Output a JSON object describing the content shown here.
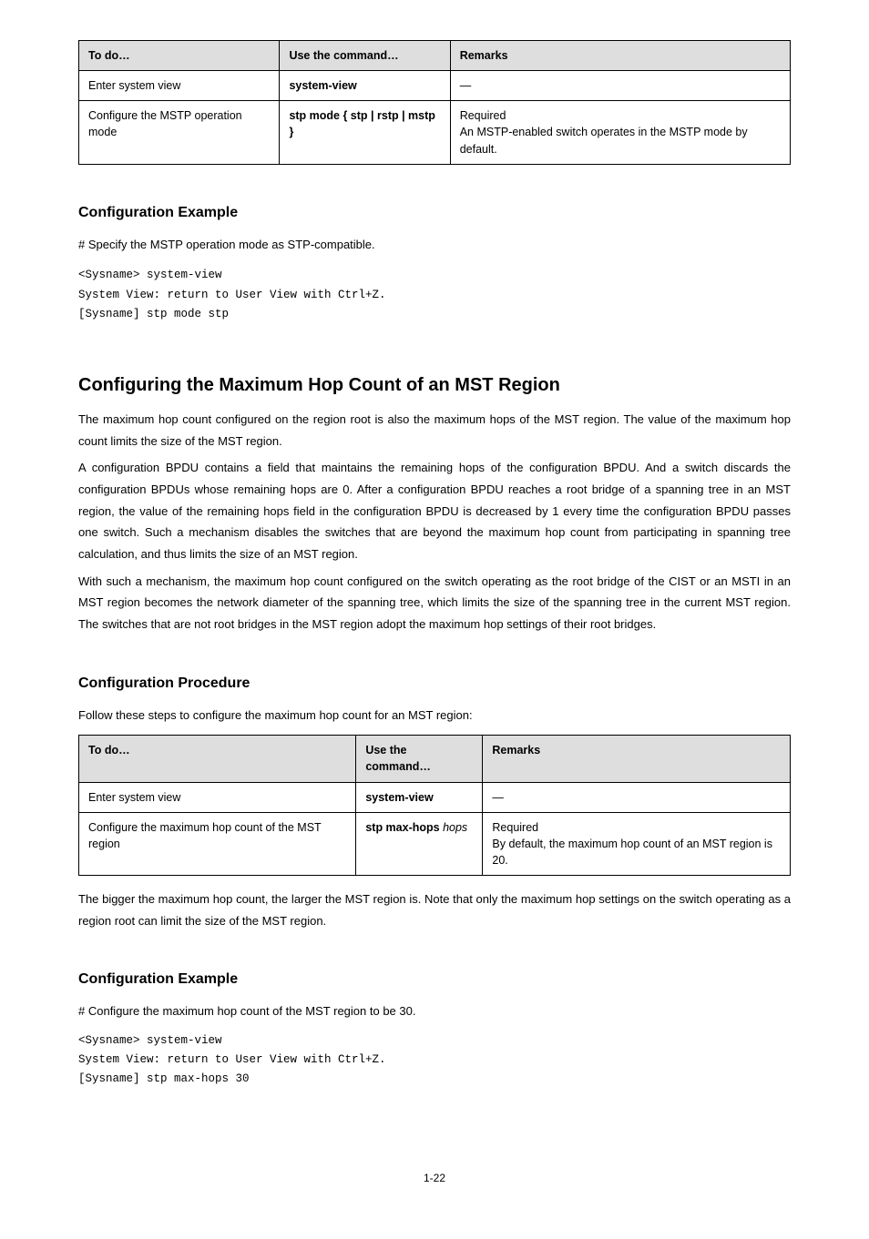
{
  "table1": {
    "headers": [
      "To do…",
      "Use the command…",
      "Remarks"
    ],
    "rows": [
      {
        "c0": "Enter system view",
        "c1": "system-view",
        "c2": "—"
      },
      {
        "c0": "Configure the MSTP operation mode",
        "c1": "stp mode { stp | rstp | mstp }",
        "c2": "Required\nAn MSTP-enabled switch operates in the MSTP mode by default."
      }
    ]
  },
  "example1": {
    "heading": "Configuration Example",
    "intro": "# Specify the MSTP operation mode as STP-compatible.",
    "lines": [
      "<Sysname> system-view",
      "System View: return to User View with Ctrl+Z.",
      "[Sysname] stp mode stp"
    ]
  },
  "section": {
    "title": "Configuring the Maximum Hop Count of an MST Region",
    "subheading": "Configuration Procedure",
    "paragraphs": [
      "The maximum hop count configured on the region root is also the maximum hops of the MST region. The value of the maximum hop count limits the size of the MST region.",
      "A configuration BPDU contains a field that maintains the remaining hops of the configuration BPDU. And a switch discards the configuration BPDUs whose remaining hops are 0. After a configuration BPDU reaches a root bridge of a spanning tree in an MST region, the value of the remaining hops field in the configuration BPDU is decreased by 1 every time the configuration BPDU passes one switch. Such a mechanism disables the switches that are beyond the maximum hop count from participating in spanning tree calculation, and thus limits the size of an MST region.",
      "With such a mechanism, the maximum hop count configured on the switch operating as the root bridge of the CIST or an MSTI in an MST region becomes the network diameter of the spanning tree, which limits the size of the spanning tree in the current MST region. The switches that are not root bridges in the MST region adopt the maximum hop settings of their root bridges."
    ],
    "table_intro": "Follow these steps to configure the maximum hop count for an MST region:"
  },
  "table2": {
    "headers": [
      "To do…",
      "Use the command…",
      "Remarks"
    ],
    "rows": [
      {
        "c0": "Enter system view",
        "c1": "system-view",
        "c2": "—"
      },
      {
        "c0": "Configure the maximum hop count of the MST region",
        "c1_prefix": "stp max-hops ",
        "c1_italic": "hops",
        "c2": "Required\nBy default, the maximum hop count of an MST region is 20."
      }
    ]
  },
  "after_note": "The bigger the maximum hop count, the larger the MST region is. Note that only the maximum hop settings on the switch operating as a region root can limit the size of the MST region.",
  "example2": {
    "heading": "Configuration Example",
    "intro": "# Configure the maximum hop count of the MST region to be 30.",
    "lines": [
      "<Sysname> system-view",
      "System View: return to User View with Ctrl+Z.",
      "[Sysname] stp max-hops 30"
    ]
  },
  "page_number": "1-22"
}
